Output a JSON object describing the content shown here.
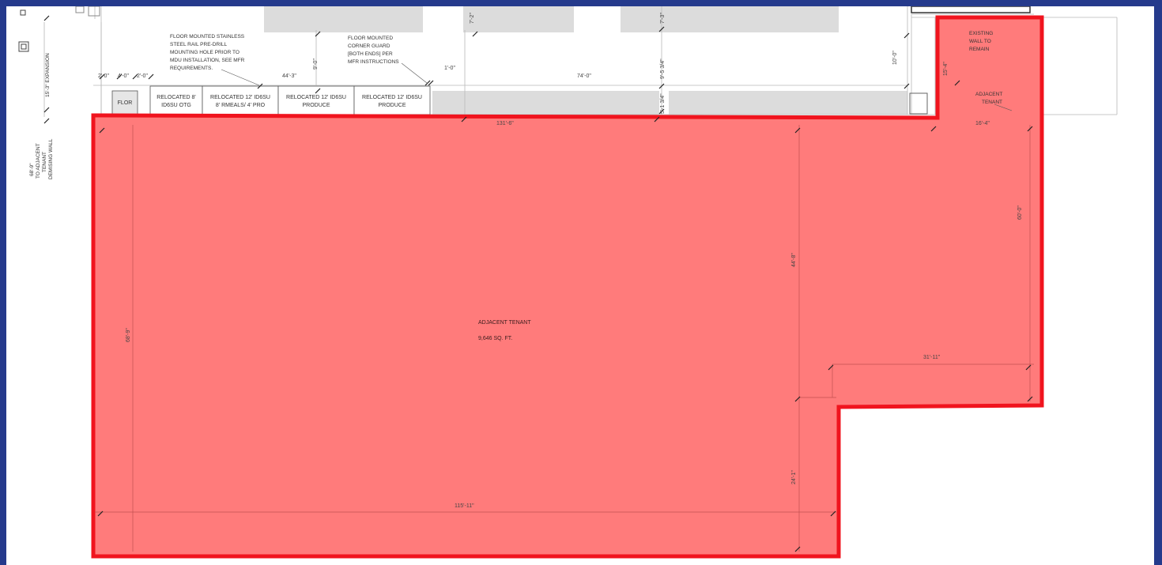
{
  "colors": {
    "frame": "#253a8c",
    "tenant_fill": "#ff7b7b",
    "tenant_outline": "#f0141e",
    "gray_block": "#dcdcdc"
  },
  "notes": {
    "expansion": "15'-3\" EXPANSION",
    "left_dim_lines": [
      "68'-9\"",
      "TO ADJACENT",
      "TENANT",
      "DEMISING WALL"
    ],
    "rail_lines": [
      "FLOOR MOUNTED STAINLESS",
      "STEEL RAIL PRE-DRILL",
      "MOUNTING HOLE PRIOR TO",
      "MDU INSTALLATION, SEE MFR",
      "REQUIREMENTS."
    ],
    "corner_lines": [
      "FLOOR MOUNTED",
      "CORNER GUARD",
      "[BOTH ENDS] PER",
      "MFR INSTRUCTIONS"
    ],
    "existing_wall_lines": [
      "EXISTING",
      "WALL TO",
      "REMAIN"
    ],
    "adjacent_small_lines": [
      "ADJACENT",
      "TENANT"
    ]
  },
  "dimensions": {
    "d_2_0_a": "2'-0\"",
    "d_4_0": "4'-0\"",
    "d_2_0_b": "2'-0\"",
    "d_44_3": "44'-3\"",
    "d_9_0": "9'-0\"",
    "d_1_0": "1'-0\"",
    "d_74_0": "74'-0\"",
    "d_7_2": "7'-2\"",
    "d_7_3": "7'-3\"",
    "d_9_5": "9'-5 3/4\"",
    "d_5_1": "5'-1 3/4\"",
    "d_10_0": "10'-0\"",
    "d_15_4": "15'-4\"",
    "d_131_6": "131'-6\"",
    "d_16_4": "16'-4\"",
    "d_60_0": "60'-0\"",
    "d_44_8": "44'-8\"",
    "d_68_9": "68'-9\"",
    "d_31_11": "31'-11\"",
    "d_24_1": "24'-1\"",
    "d_115_11": "115'-11\""
  },
  "fixtures": [
    {
      "line1": "FLOR",
      "line2": ""
    },
    {
      "line1": "RELOCATED 8'",
      "line2": "ID6SU OTG"
    },
    {
      "line1": "RELOCATED 12' ID6SU",
      "line2": "8' RMEALS/ 4' PRO"
    },
    {
      "line1": "RELOCATED 12' ID6SU",
      "line2": "PRODUCE"
    },
    {
      "line1": "RELOCATED 12' ID6SU",
      "line2": "PRODUCE"
    }
  ],
  "tenant": {
    "name": "ADJACENT TENANT",
    "area": "9,646 SQ. FT."
  }
}
